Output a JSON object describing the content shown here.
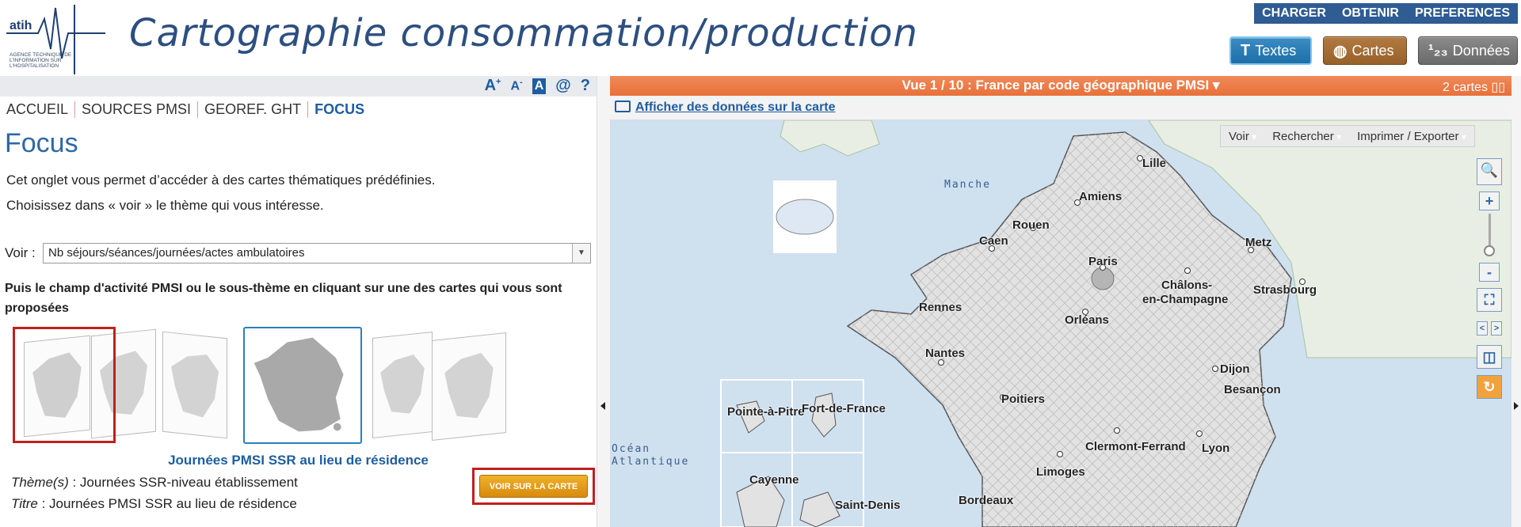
{
  "header": {
    "logo_text": "atih",
    "logo_tagline": "AGENCE TECHNIQUE DE L'INFORMATION SUR L'HOSPITALISATION",
    "app_title": "Cartographie consommation/production",
    "top_menu": [
      "CHARGER",
      "OBTENIR",
      "PREFERENCES"
    ],
    "modes": {
      "textes": "Textes",
      "cartes": "Cartes",
      "donnees": "Données"
    }
  },
  "left_toolbar": {
    "font_up": "A",
    "font_down": "A",
    "contrast": "A",
    "contact": "@",
    "help": "?"
  },
  "breadcrumbs": [
    "ACCUEIL",
    "SOURCES PMSI",
    "GEOREF. GHT",
    "FOCUS"
  ],
  "focus": {
    "title": "Focus",
    "para1": "Cet onglet vous permet d’accéder à des cartes thématiques prédéfinies.",
    "para2": "Choisissez dans « voir » le thème qui vous intéresse.",
    "voir_label": "Voir :",
    "voir_value": "Nb séjours/séances/journées/actes ambulatoires",
    "instruction": "Puis le champ d'activité PMSI ou le sous-thème en cliquant sur une des cartes qui vous sont proposées",
    "thumb_caption": "Journées PMSI SSR au lieu de résidence",
    "theme_label": "Thème(s)",
    "theme_value": " : Journées SSR-niveau établissement",
    "titre_label": "Titre",
    "titre_value": " : Journées PMSI SSR au lieu de résidence",
    "voir_button": "VOIR SUR LA CARTE"
  },
  "map_panel": {
    "view_title": "Vue 1 / 10 : France par code géographique PMSI ▾",
    "cards_count": "2 cartes ▯▯",
    "data_link": "Afficher des données sur la carte",
    "menu": [
      "Voir",
      "Rechercher",
      "Imprimer / Exporter"
    ],
    "seas": {
      "manche": "Manche",
      "ocean1": "Océan",
      "ocean2": "Atlantique"
    },
    "cities": [
      "Lille",
      "Amiens",
      "Rouen",
      "Caen",
      "Paris",
      "Metz",
      "Châlons-",
      "en-Champagne",
      "Strasbourg",
      "Rennes",
      "Orléans",
      "Nantes",
      "Dijon",
      "Besançon",
      "Poitiers",
      "Clermont-Ferrand",
      "Lyon",
      "Limoges",
      "Bordeaux"
    ],
    "insets": [
      "Pointe-à-Pitre",
      "Fort-de-France",
      "Cayenne",
      "Saint-Denis"
    ]
  },
  "colors": {
    "accent": "#1e5da0",
    "view_bar": "#e8703a",
    "highlight": "#c0201f"
  }
}
